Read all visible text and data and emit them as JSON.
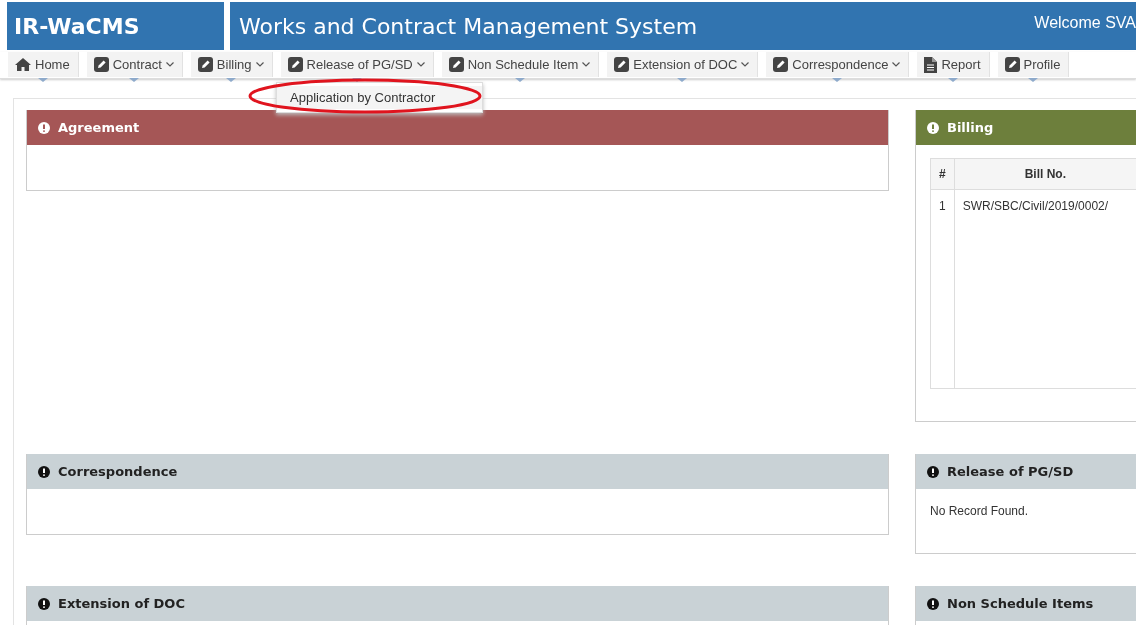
{
  "header": {
    "logo": "IR-WaCMS",
    "title": "Works and Contract Management System",
    "welcome": "Welcome SVA"
  },
  "menu": [
    {
      "label": "Home",
      "kind": "home",
      "caret": false
    },
    {
      "label": "Contract",
      "kind": "edit",
      "caret": true
    },
    {
      "label": "Billing",
      "kind": "edit",
      "caret": true
    },
    {
      "label": "Release of PG/SD",
      "kind": "edit",
      "caret": true,
      "dropdown": [
        {
          "label": "Application by Contractor",
          "circled": true
        }
      ]
    },
    {
      "label": "Non Schedule Item",
      "kind": "edit",
      "caret": true
    },
    {
      "label": "Extension of DOC",
      "kind": "edit",
      "caret": true
    },
    {
      "label": "Correspondence",
      "kind": "edit",
      "caret": true
    },
    {
      "label": "Report",
      "kind": "file",
      "caret": false
    },
    {
      "label": "Profile",
      "kind": "edit",
      "caret": false
    }
  ],
  "panels": [
    {
      "title": "Agreement",
      "color": "#a55656",
      "body": {
        "kind": "empty"
      }
    },
    {
      "title": "Billing",
      "color": "#6d7f3c",
      "body": {
        "kind": "table",
        "columns": [
          "#",
          "Bill No."
        ],
        "rows": [
          [
            "1",
            "SWR/SBC/Civil/2019/0002/"
          ]
        ]
      }
    },
    {
      "title": "Correspondence",
      "color": "#c9d2d6",
      "body": {
        "kind": "empty"
      }
    },
    {
      "title": "Release of PG/SD",
      "color": "#c9d2d6",
      "body": {
        "kind": "message",
        "text": "No Record Found."
      }
    },
    {
      "title": "Extension of DOC",
      "color": "#c9d2d6",
      "body": {
        "kind": "empty"
      }
    },
    {
      "title": "Non Schedule Items",
      "color": "#c9d2d6",
      "body": {
        "kind": "empty"
      }
    }
  ]
}
